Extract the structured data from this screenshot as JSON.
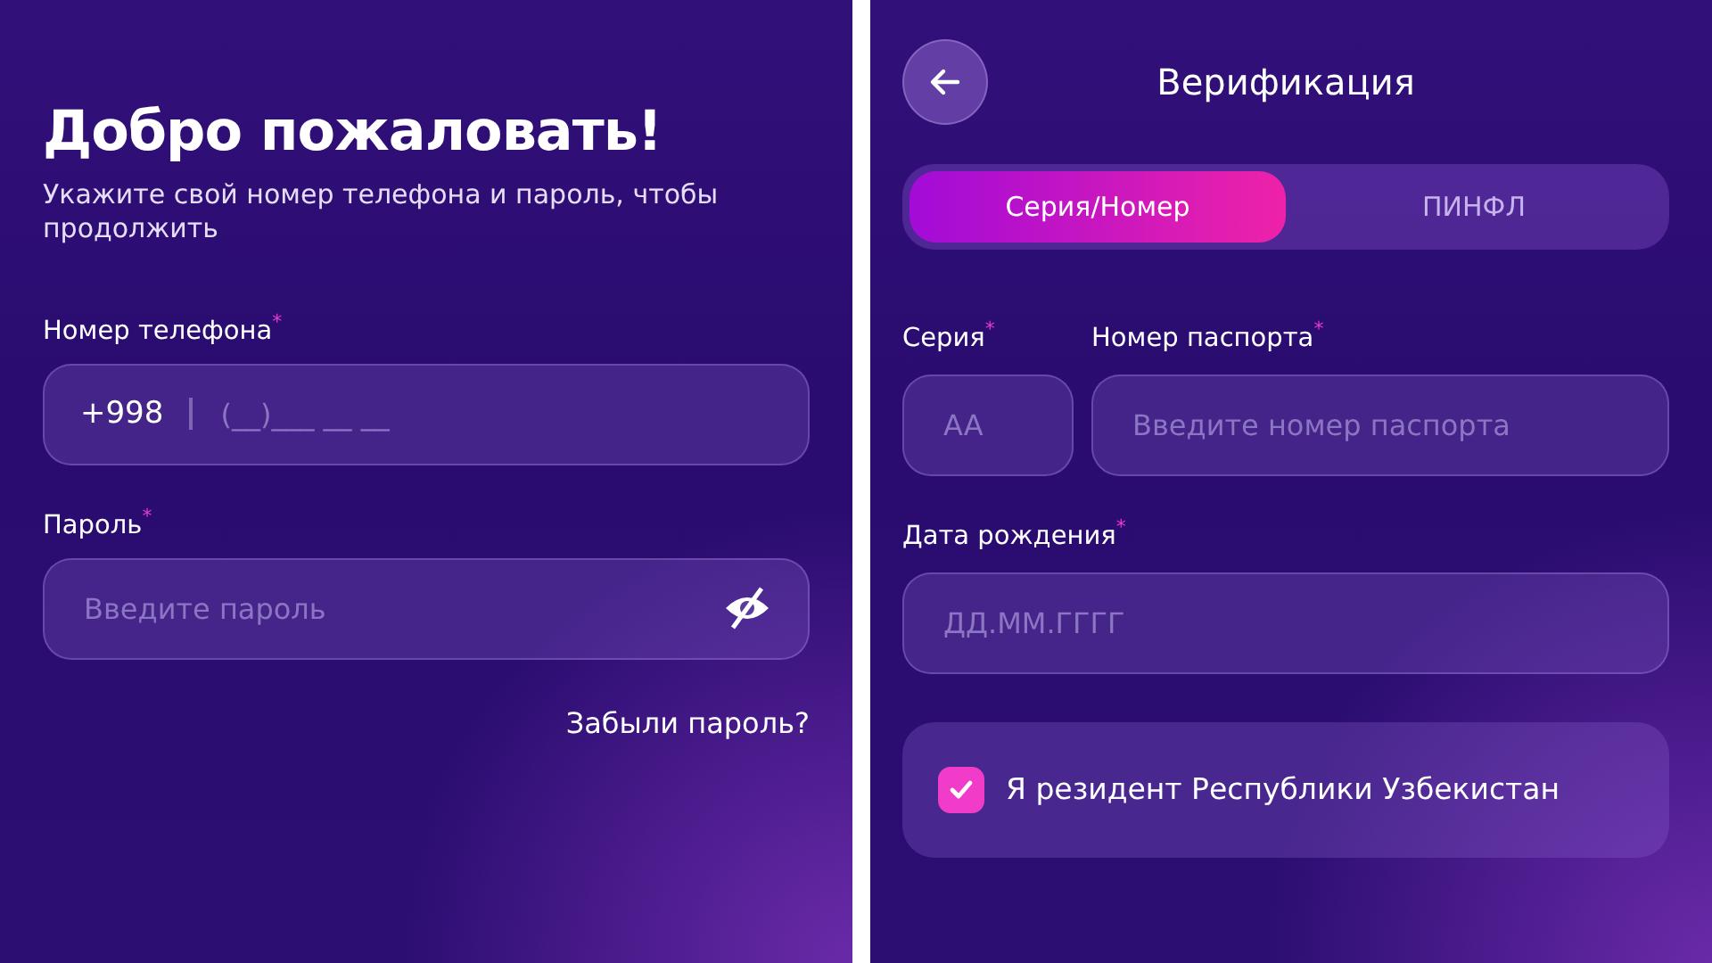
{
  "login": {
    "title": "Добро пожаловать!",
    "subtitle": "Укажите свой номер телефона и пароль, чтобы продолжить",
    "phone": {
      "label": "Номер телефона",
      "required_mark": "*",
      "prefix": "+998",
      "placeholder": "(__)___ __ __"
    },
    "password": {
      "label": "Пароль",
      "required_mark": "*",
      "placeholder": "Введите пароль",
      "visible": false
    },
    "forgot_link": "Забыли пароль?"
  },
  "verification": {
    "title": "Верификация",
    "tabs": [
      {
        "label": "Серия/Номер",
        "selected": true
      },
      {
        "label": "ПИНФЛ",
        "selected": false
      }
    ],
    "series": {
      "label": "Серия",
      "required_mark": "*",
      "placeholder": "AA"
    },
    "passport_number": {
      "label": "Номер паспорта",
      "required_mark": "*",
      "placeholder": "Введите номер паспорта"
    },
    "birth_date": {
      "label": "Дата рождения",
      "required_mark": "*",
      "placeholder": "ДД.ММ.ГГГГ"
    },
    "resident": {
      "label": "Я резидент Республики Узбекистан",
      "checked": true
    }
  }
}
